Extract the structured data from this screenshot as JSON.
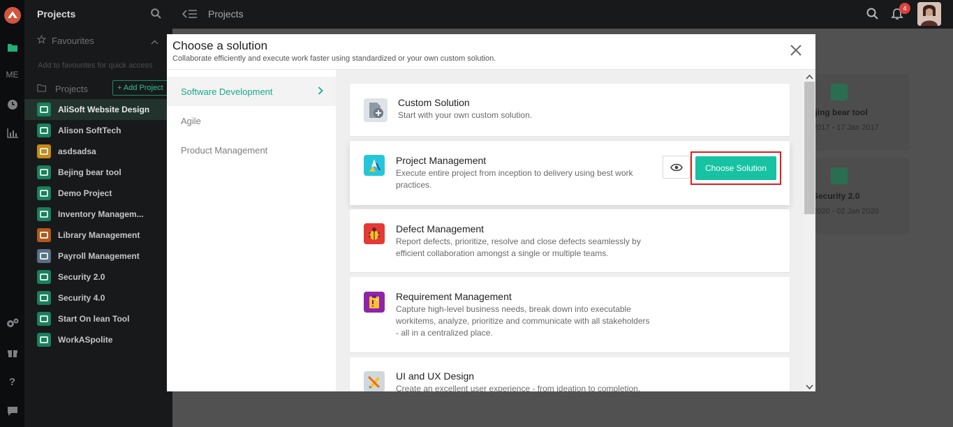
{
  "rail": {
    "items": [
      {
        "icon": "logo-icon"
      },
      {
        "icon": "folder-icon"
      },
      {
        "label": "ME"
      },
      {
        "icon": "clock-icon"
      },
      {
        "icon": "bar-chart-icon"
      },
      {
        "icon": "settings-icon"
      },
      {
        "icon": "gift-icon"
      },
      {
        "icon": "help-icon"
      },
      {
        "icon": "chat-icon"
      }
    ],
    "me_label": "ME"
  },
  "sidebar": {
    "title": "Projects",
    "favourites_label": "Favourites",
    "favourites_hint": "Add to favourites for quick access",
    "projects_label": "Projects",
    "add_project_label": "+ Add Project",
    "projects": [
      {
        "name": "AliSoft Website Design",
        "color": "#1a7f5c"
      },
      {
        "name": "Alison SoftTech",
        "color": "#1a7f5c"
      },
      {
        "name": "asdsadsa",
        "color": "#c78a14"
      },
      {
        "name": "Bejing bear tool",
        "color": "#1a7f5c"
      },
      {
        "name": "Demo Project",
        "color": "#1a7f5c"
      },
      {
        "name": "Inventory Managem...",
        "color": "#1a7f5c"
      },
      {
        "name": "Library Management",
        "color": "#b5561c"
      },
      {
        "name": "Payroll Management",
        "color": "#5a6f87"
      },
      {
        "name": "Security 2.0",
        "color": "#1a7f5c"
      },
      {
        "name": "Security 4.0",
        "color": "#1a7f5c"
      },
      {
        "name": "Start On lean Tool",
        "color": "#1a7f5c"
      },
      {
        "name": "WorkASpolite",
        "color": "#1a7f5c"
      }
    ]
  },
  "topbar": {
    "title": "Projects",
    "notification_count": "4"
  },
  "background_cards": [
    {
      "name": "ijing bear tool",
      "dates": "2017 - 17 Jan 2017"
    },
    {
      "name": "Security 2.0",
      "dates": "2020 - 02 Jan 2020"
    }
  ],
  "modal": {
    "title": "Choose a solution",
    "subtitle": "Collaborate efficiently and execute work faster using standardized or your own custom solution.",
    "categories": [
      "Software Development",
      "Agile",
      "Product Management"
    ],
    "solutions": [
      {
        "title": "Custom Solution",
        "description": "Start with your own custom solution.",
        "icon_color": "#7b8790"
      },
      {
        "title": "Project Management",
        "description": "Execute entire project from inception to delivery using best work practices.",
        "icon_color": "#26c6da"
      },
      {
        "title": "Defect Management",
        "description": "Report defects, prioritize, resolve and close defects seamlessly by efficient collaboration amongst a single or multiple teams.",
        "icon_color": "#e53935"
      },
      {
        "title": "Requirement Management",
        "description": "Capture high-level business needs, break down into executable workitems, analyze, prioritize and communicate with all stakeholders - all in a centralized place.",
        "icon_color": "#8e24aa"
      },
      {
        "title": "UI and UX Design",
        "description": "Create an excellent user experience - from ideation to completion.",
        "icon_color": "#b0bec5"
      }
    ],
    "choose_label": "Choose Solution",
    "accent_color": "#16c2a2",
    "highlight_color": "#e21c1c"
  }
}
